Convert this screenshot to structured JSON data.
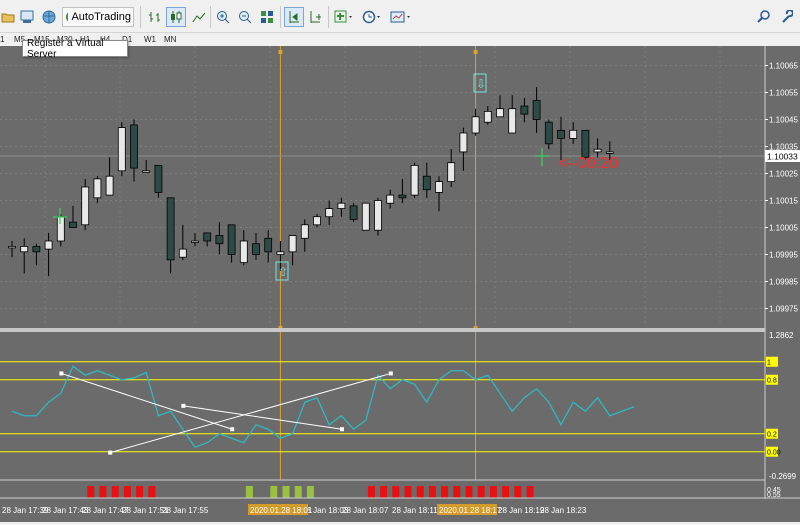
{
  "app": {
    "title_fragment": "p"
  },
  "toolbar": {
    "autotrading_label": "AutoTrading",
    "buttons": [
      "open-folder-icon",
      "print-icon",
      "globe-icon",
      "autotrading-icon",
      "bar-chart-icon",
      "candlestick-chart-icon",
      "line-chart-icon",
      "zoom-in-icon",
      "zoom-out-icon",
      "tile-windows-icon",
      "chart-shift-icon",
      "autoscroll-icon",
      "indicators-icon",
      "periods-icon",
      "templates-icon",
      "search-icon",
      "settings-icon"
    ]
  },
  "timeframes": [
    "1",
    "M5",
    "M15",
    "M30",
    "H1",
    "H4",
    "D1",
    "W1",
    "MN"
  ],
  "tooltip": {
    "text": "Register a Virtual Server"
  },
  "colors": {
    "background": "#6b6b6b",
    "bull_body": "#e8e8e8",
    "bear_body": "#2e4a47",
    "wick": "#000000",
    "level_line": "#ffff00",
    "oscillator": "#2fb8c0",
    "vline": "#e0a030",
    "bid_line": "#8e8e8e",
    "countdown": "#ff2a2a",
    "osc_grid": "#ffff00"
  },
  "price_axis": {
    "labels": [
      "1.10065",
      "1.10055",
      "1.10045",
      "1.10035",
      "1.10025",
      "1.10015",
      "1.10005",
      "1.09995",
      "1.09985",
      "1.09975"
    ],
    "current_price": "1.10033"
  },
  "countdown": "<--00:20",
  "arrow_up_label": "⇧",
  "arrow_down_label": "⇩",
  "oscillator_axis": {
    "top": "1.2862",
    "levels": [
      {
        "label": "1",
        "value": 1.0
      },
      {
        "label": "0.8",
        "value": 0.8
      },
      {
        "label": "0.2",
        "value": 0.2
      },
      {
        "label": "0.00",
        "value": 0.0
      }
    ],
    "bottom": "-0.2699",
    "bottom2": "0.45",
    "bottom3": "0.55"
  },
  "time_axis": {
    "labels": [
      "28 Jan 17:39",
      "28 Jan 17:43",
      "28 Jan 17:47",
      "28 Jan 17:51",
      "28 Jan 17:55",
      "28 Jan 18:03",
      "28 Jan 18:07",
      "28 Jan 18:11",
      "28 Jan 18:19",
      "28 Jan 18:23"
    ],
    "highlighted": [
      "2020.01.28 18:01",
      "2020.01.28 18:17"
    ]
  },
  "chart_data": {
    "type": "candlestick",
    "ylim": [
      1.0997,
      1.1007
    ],
    "candles": [
      {
        "o": 1.09998,
        "h": 1.1,
        "l": 1.09994,
        "c": 1.09998
      },
      {
        "o": 1.09996,
        "h": 1.10001,
        "l": 1.09988,
        "c": 1.09998
      },
      {
        "o": 1.09998,
        "h": 1.09999,
        "l": 1.09991,
        "c": 1.09996
      },
      {
        "o": 1.09997,
        "h": 1.10003,
        "l": 1.09987,
        "c": 1.1
      },
      {
        "o": 1.1,
        "h": 1.1001,
        "l": 1.09998,
        "c": 1.10009
      },
      {
        "o": 1.10007,
        "h": 1.10013,
        "l": 1.10005,
        "c": 1.10005
      },
      {
        "o": 1.10006,
        "h": 1.10023,
        "l": 1.10004,
        "c": 1.1002
      },
      {
        "o": 1.10016,
        "h": 1.10024,
        "l": 1.10014,
        "c": 1.10023
      },
      {
        "o": 1.10017,
        "h": 1.10031,
        "l": 1.10017,
        "c": 1.10024
      },
      {
        "o": 1.10026,
        "h": 1.10044,
        "l": 1.10024,
        "c": 1.10042
      },
      {
        "o": 1.10043,
        "h": 1.10045,
        "l": 1.10022,
        "c": 1.10027
      },
      {
        "o": 1.10026,
        "h": 1.1003,
        "l": 1.10026,
        "c": 1.10026
      },
      {
        "o": 1.10028,
        "h": 1.10028,
        "l": 1.10016,
        "c": 1.10018
      },
      {
        "o": 1.10016,
        "h": 1.10016,
        "l": 1.09988,
        "c": 1.09993
      },
      {
        "o": 1.09994,
        "h": 1.10006,
        "l": 1.09993,
        "c": 1.09997
      },
      {
        "o": 1.1,
        "h": 1.10003,
        "l": 1.09998,
        "c": 1.1
      },
      {
        "o": 1.10003,
        "h": 1.1,
        "l": 1.09998,
        "c": 1.1
      },
      {
        "o": 1.10002,
        "h": 1.10007,
        "l": 1.09995,
        "c": 1.09999
      },
      {
        "o": 1.10006,
        "h": 1.10006,
        "l": 1.09992,
        "c": 1.09995
      },
      {
        "o": 1.09992,
        "h": 1.10004,
        "l": 1.09991,
        "c": 1.1
      },
      {
        "o": 1.09999,
        "h": 1.10003,
        "l": 1.09993,
        "c": 1.09995
      },
      {
        "o": 1.10001,
        "h": 1.10004,
        "l": 1.09992,
        "c": 1.09996
      },
      {
        "o": 1.09995,
        "h": 1.1,
        "l": 1.09989,
        "c": 1.09996
      },
      {
        "o": 1.09996,
        "h": 1.10002,
        "l": 1.09991,
        "c": 1.10002
      },
      {
        "o": 1.10001,
        "h": 1.10008,
        "l": 1.09996,
        "c": 1.10006
      },
      {
        "o": 1.10006,
        "h": 1.1001,
        "l": 1.10005,
        "c": 1.10009
      },
      {
        "o": 1.10009,
        "h": 1.10015,
        "l": 1.10006,
        "c": 1.10012
      },
      {
        "o": 1.10012,
        "h": 1.10016,
        "l": 1.10009,
        "c": 1.10014
      },
      {
        "o": 1.10013,
        "h": 1.10014,
        "l": 1.10007,
        "c": 1.10008
      },
      {
        "o": 1.10004,
        "h": 1.10014,
        "l": 1.10004,
        "c": 1.10014
      },
      {
        "o": 1.10004,
        "h": 1.10016,
        "l": 1.10002,
        "c": 1.10015
      },
      {
        "o": 1.10014,
        "h": 1.10019,
        "l": 1.10012,
        "c": 1.10017
      },
      {
        "o": 1.10017,
        "h": 1.10023,
        "l": 1.10014,
        "c": 1.10016
      },
      {
        "o": 1.10017,
        "h": 1.10029,
        "l": 1.10016,
        "c": 1.10028
      },
      {
        "o": 1.10024,
        "h": 1.10029,
        "l": 1.10016,
        "c": 1.10019
      },
      {
        "o": 1.10018,
        "h": 1.10024,
        "l": 1.10011,
        "c": 1.10022
      },
      {
        "o": 1.10022,
        "h": 1.10034,
        "l": 1.1002,
        "c": 1.10029
      },
      {
        "o": 1.10033,
        "h": 1.10042,
        "l": 1.10026,
        "c": 1.1004
      },
      {
        "o": 1.1004,
        "h": 1.10049,
        "l": 1.10039,
        "c": 1.10046
      },
      {
        "o": 1.10044,
        "h": 1.1005,
        "l": 1.10043,
        "c": 1.10048
      },
      {
        "o": 1.10046,
        "h": 1.10054,
        "l": 1.10046,
        "c": 1.10049
      },
      {
        "o": 1.1004,
        "h": 1.10054,
        "l": 1.1004,
        "c": 1.10049
      },
      {
        "o": 1.1005,
        "h": 1.10053,
        "l": 1.10044,
        "c": 1.10047
      },
      {
        "o": 1.10052,
        "h": 1.10057,
        "l": 1.1004,
        "c": 1.10045
      },
      {
        "o": 1.10044,
        "h": 1.10045,
        "l": 1.10034,
        "c": 1.10036
      },
      {
        "o": 1.10041,
        "h": 1.10046,
        "l": 1.1003,
        "c": 1.10038
      },
      {
        "o": 1.10038,
        "h": 1.10044,
        "l": 1.10036,
        "c": 1.10041
      },
      {
        "o": 1.10041,
        "h": 1.10041,
        "l": 1.1003,
        "c": 1.10031
      },
      {
        "o": 1.10033,
        "h": 1.10038,
        "l": 1.10031,
        "c": 1.10034
      },
      {
        "o": 1.10033,
        "h": 1.10037,
        "l": 1.1003,
        "c": 1.10033
      }
    ],
    "oscillator": [
      0.45,
      0.4,
      0.4,
      0.55,
      0.65,
      0.95,
      0.85,
      0.9,
      0.85,
      0.8,
      0.82,
      0.88,
      0.4,
      0.45,
      0.25,
      0.05,
      0.1,
      0.2,
      0.15,
      0.1,
      0.3,
      0.25,
      0.15,
      0.2,
      0.55,
      0.6,
      0.3,
      0.4,
      0.25,
      0.35,
      0.85,
      0.7,
      0.8,
      0.75,
      0.55,
      0.8,
      0.9,
      0.9,
      0.8,
      0.85,
      0.65,
      0.45,
      0.6,
      0.7,
      0.55,
      0.3,
      0.55,
      0.45,
      0.6,
      0.4,
      0.45,
      0.5
    ],
    "trendlines": [
      {
        "from": [
          7,
          0.87
        ],
        "to": [
          21,
          0.25
        ]
      },
      {
        "from": [
          11,
          -0.01
        ],
        "to": [
          34,
          0.87
        ]
      },
      {
        "from": [
          17,
          0.51
        ],
        "to": [
          30,
          0.25
        ]
      }
    ],
    "signals": [
      {
        "bar": 4,
        "color": "red"
      },
      {
        "bar": 5,
        "color": "red"
      },
      {
        "bar": 6,
        "color": "red"
      },
      {
        "bar": 7,
        "color": "red"
      },
      {
        "bar": 8,
        "color": "red"
      },
      {
        "bar": 9,
        "color": "red"
      },
      {
        "bar": 17,
        "color": "green"
      },
      {
        "bar": 19,
        "color": "green"
      },
      {
        "bar": 20,
        "color": "green"
      },
      {
        "bar": 21,
        "color": "green"
      },
      {
        "bar": 22,
        "color": "green"
      },
      {
        "bar": 27,
        "color": "red"
      },
      {
        "bar": 28,
        "color": "red"
      },
      {
        "bar": 29,
        "color": "red"
      },
      {
        "bar": 30,
        "color": "red"
      },
      {
        "bar": 31,
        "color": "red"
      },
      {
        "bar": 32,
        "color": "red"
      },
      {
        "bar": 33,
        "color": "red"
      },
      {
        "bar": 34,
        "color": "red"
      },
      {
        "bar": 35,
        "color": "red"
      },
      {
        "bar": 36,
        "color": "red"
      },
      {
        "bar": 37,
        "color": "red"
      },
      {
        "bar": 38,
        "color": "red"
      },
      {
        "bar": 39,
        "color": "red"
      },
      {
        "bar": 40,
        "color": "red"
      }
    ],
    "vlines": [
      22,
      38
    ]
  }
}
